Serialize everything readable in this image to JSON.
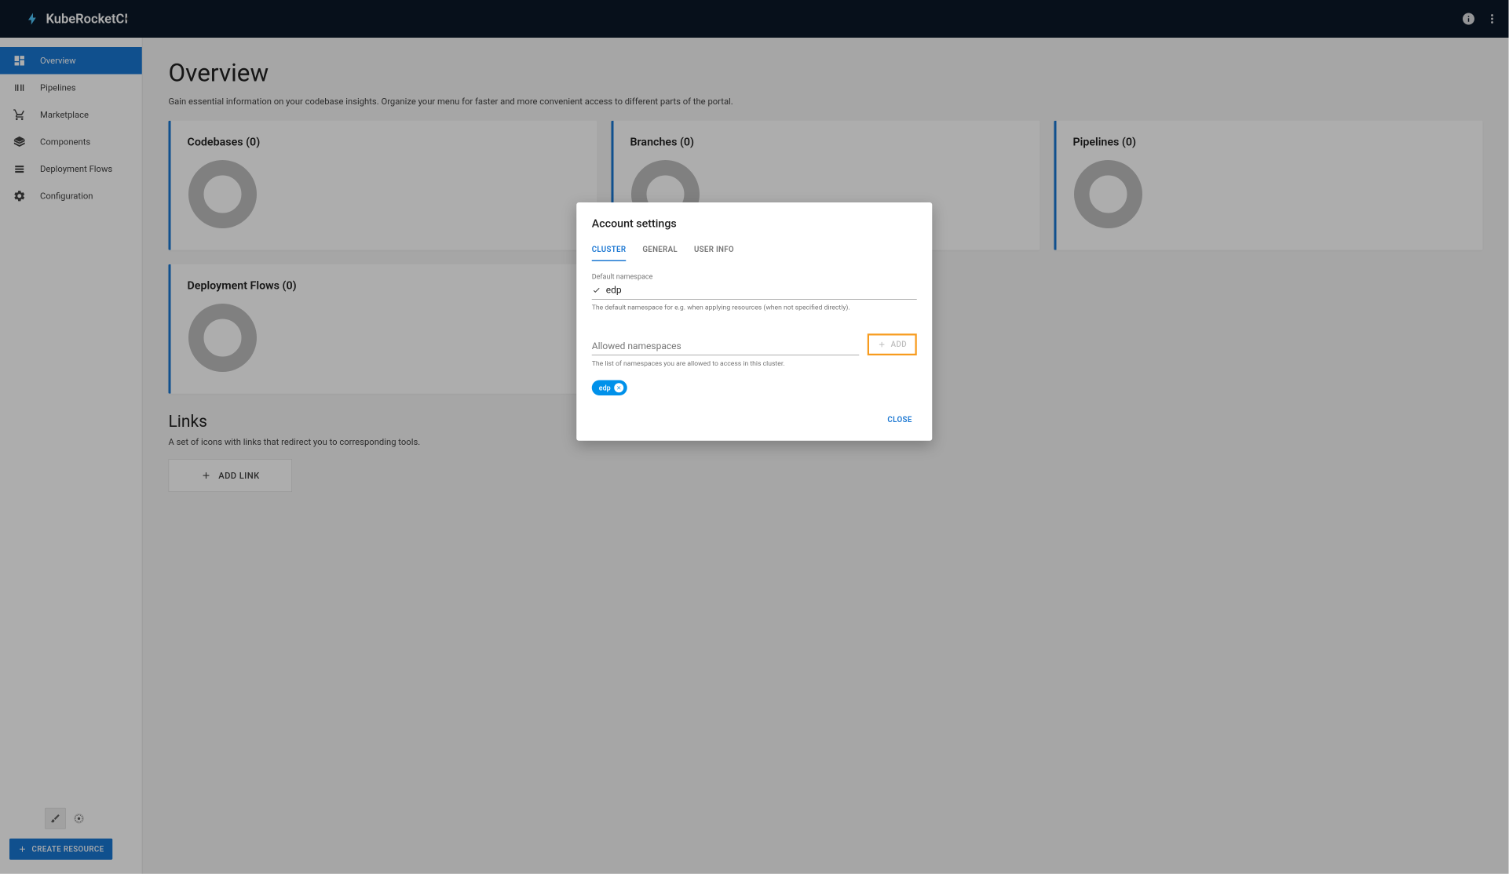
{
  "app": {
    "title": "KubeRocketCI"
  },
  "sidebar": {
    "items": [
      {
        "label": "Overview"
      },
      {
        "label": "Pipelines"
      },
      {
        "label": "Marketplace"
      },
      {
        "label": "Components"
      },
      {
        "label": "Deployment Flows"
      },
      {
        "label": "Configuration"
      }
    ],
    "create": "CREATE RESOURCE"
  },
  "page": {
    "title": "Overview",
    "description": "Gain essential information on your codebase insights. Organize your menu for faster and more convenient access to different parts of the portal."
  },
  "cards": [
    {
      "title": "Codebases (0)"
    },
    {
      "title": "Branches (0)"
    },
    {
      "title": "Pipelines (0)"
    },
    {
      "title": "Deployment Flows (0)"
    }
  ],
  "links": {
    "title": "Links",
    "description": "A set of icons with links that redirect you to corresponding tools.",
    "add": "ADD LINK"
  },
  "modal": {
    "title": "Account settings",
    "tabs": [
      {
        "label": "CLUSTER"
      },
      {
        "label": "GENERAL"
      },
      {
        "label": "USER INFO"
      }
    ],
    "defaultNs": {
      "label": "Default namespace",
      "value": "edp",
      "help": "The default namespace for e.g. when applying resources (when not specified directly)."
    },
    "allowedNs": {
      "placeholder": "Allowed namespaces",
      "help": "The list of namespaces you are allowed to access in this cluster.",
      "add": "ADD"
    },
    "chip": "edp",
    "close": "CLOSE"
  }
}
